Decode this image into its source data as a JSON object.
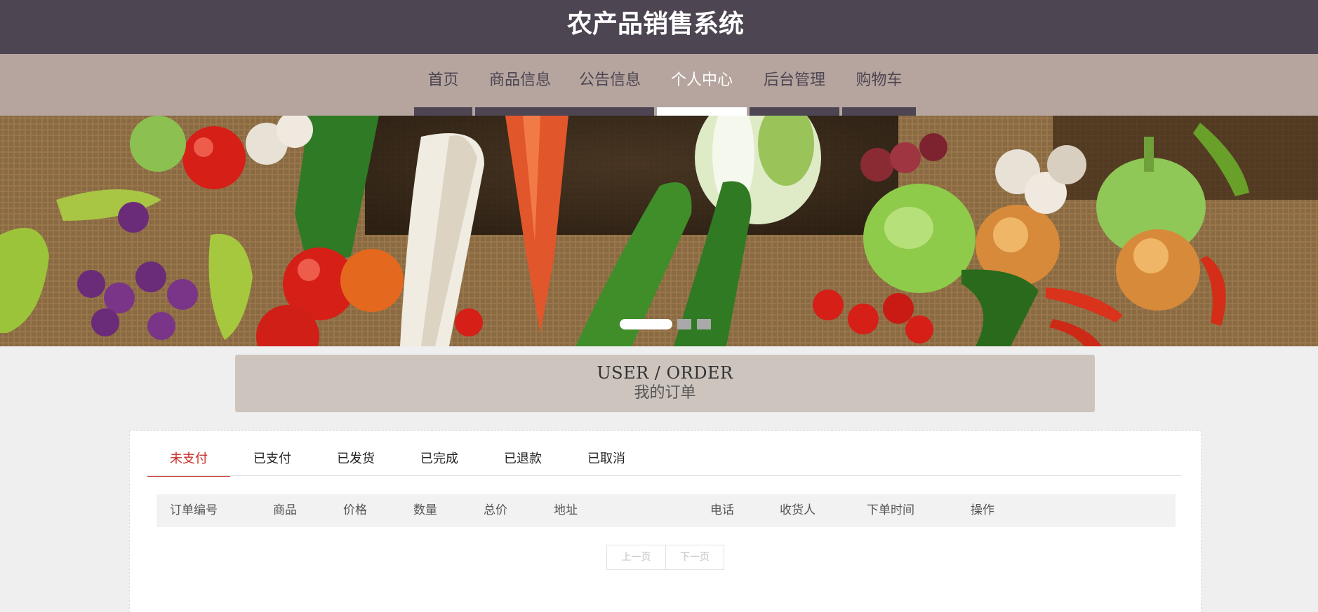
{
  "header": {
    "title": "农产品销售系统"
  },
  "nav": {
    "items": [
      {
        "label": "首页"
      },
      {
        "label": "商品信息"
      },
      {
        "label": "公告信息"
      },
      {
        "label": "个人中心"
      },
      {
        "label": "后台管理"
      },
      {
        "label": "购物车"
      }
    ],
    "active_index": 3
  },
  "banner": {
    "slide_count": 3,
    "active_slide": 1
  },
  "section": {
    "title_en": "USER / ORDER",
    "title_cn": "我的订单"
  },
  "order_tabs": {
    "items": [
      {
        "label": "未支付"
      },
      {
        "label": "已支付"
      },
      {
        "label": "已发货"
      },
      {
        "label": "已完成"
      },
      {
        "label": "已退款"
      },
      {
        "label": "已取消"
      }
    ],
    "active_index": 0
  },
  "table": {
    "columns": [
      "订单编号",
      "商品",
      "价格",
      "数量",
      "总价",
      "地址",
      "电话",
      "收货人",
      "下单时间",
      "操作"
    ],
    "rows": []
  },
  "pagination": {
    "prev_label": "上一页",
    "next_label": "下一页"
  },
  "colors": {
    "header_bg": "#4d4552",
    "nav_bg": "#b5a59e",
    "section_header_bg": "#cdc4bd",
    "active_tab": "#c9302c",
    "page_bg": "#efefef"
  }
}
